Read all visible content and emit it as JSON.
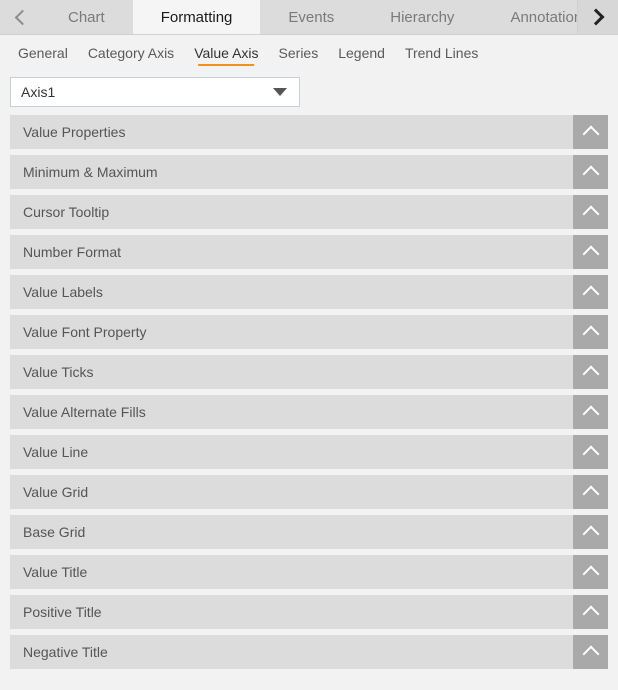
{
  "tabbar": {
    "prev_icon": "chevron-left-icon",
    "next_icon": "chevron-right-icon",
    "tabs": [
      {
        "label": "Chart",
        "active": false
      },
      {
        "label": "Formatting",
        "active": true
      },
      {
        "label": "Events",
        "active": false
      },
      {
        "label": "Hierarchy",
        "active": false
      },
      {
        "label": "Annotation",
        "active": false
      }
    ]
  },
  "subtabs": {
    "accent_color": "#f0921e",
    "items": [
      {
        "label": "General",
        "active": false
      },
      {
        "label": "Category Axis",
        "active": false
      },
      {
        "label": "Value Axis",
        "active": true
      },
      {
        "label": "Series",
        "active": false
      },
      {
        "label": "Legend",
        "active": false
      },
      {
        "label": "Trend Lines",
        "active": false
      }
    ]
  },
  "axis_selector": {
    "value": "Axis1",
    "caret_icon": "caret-down-icon"
  },
  "sections": {
    "toggle_icon": "chevron-up-icon",
    "items": [
      {
        "label": "Value Properties"
      },
      {
        "label": "Minimum & Maximum"
      },
      {
        "label": "Cursor Tooltip"
      },
      {
        "label": "Number Format"
      },
      {
        "label": "Value Labels"
      },
      {
        "label": "Value Font Property"
      },
      {
        "label": "Value Ticks"
      },
      {
        "label": "Value Alternate Fills"
      },
      {
        "label": "Value Line"
      },
      {
        "label": "Value Grid"
      },
      {
        "label": "Base Grid"
      },
      {
        "label": "Value Title"
      },
      {
        "label": "Positive Title"
      },
      {
        "label": "Negative Title"
      }
    ]
  },
  "colors": {
    "page_background": "#f2f2f2",
    "row_background": "#dcdcdc",
    "row_toggle_background": "#a9a9a9",
    "active_tab_background": "#f5f5f5",
    "accent": "#f0921e"
  }
}
